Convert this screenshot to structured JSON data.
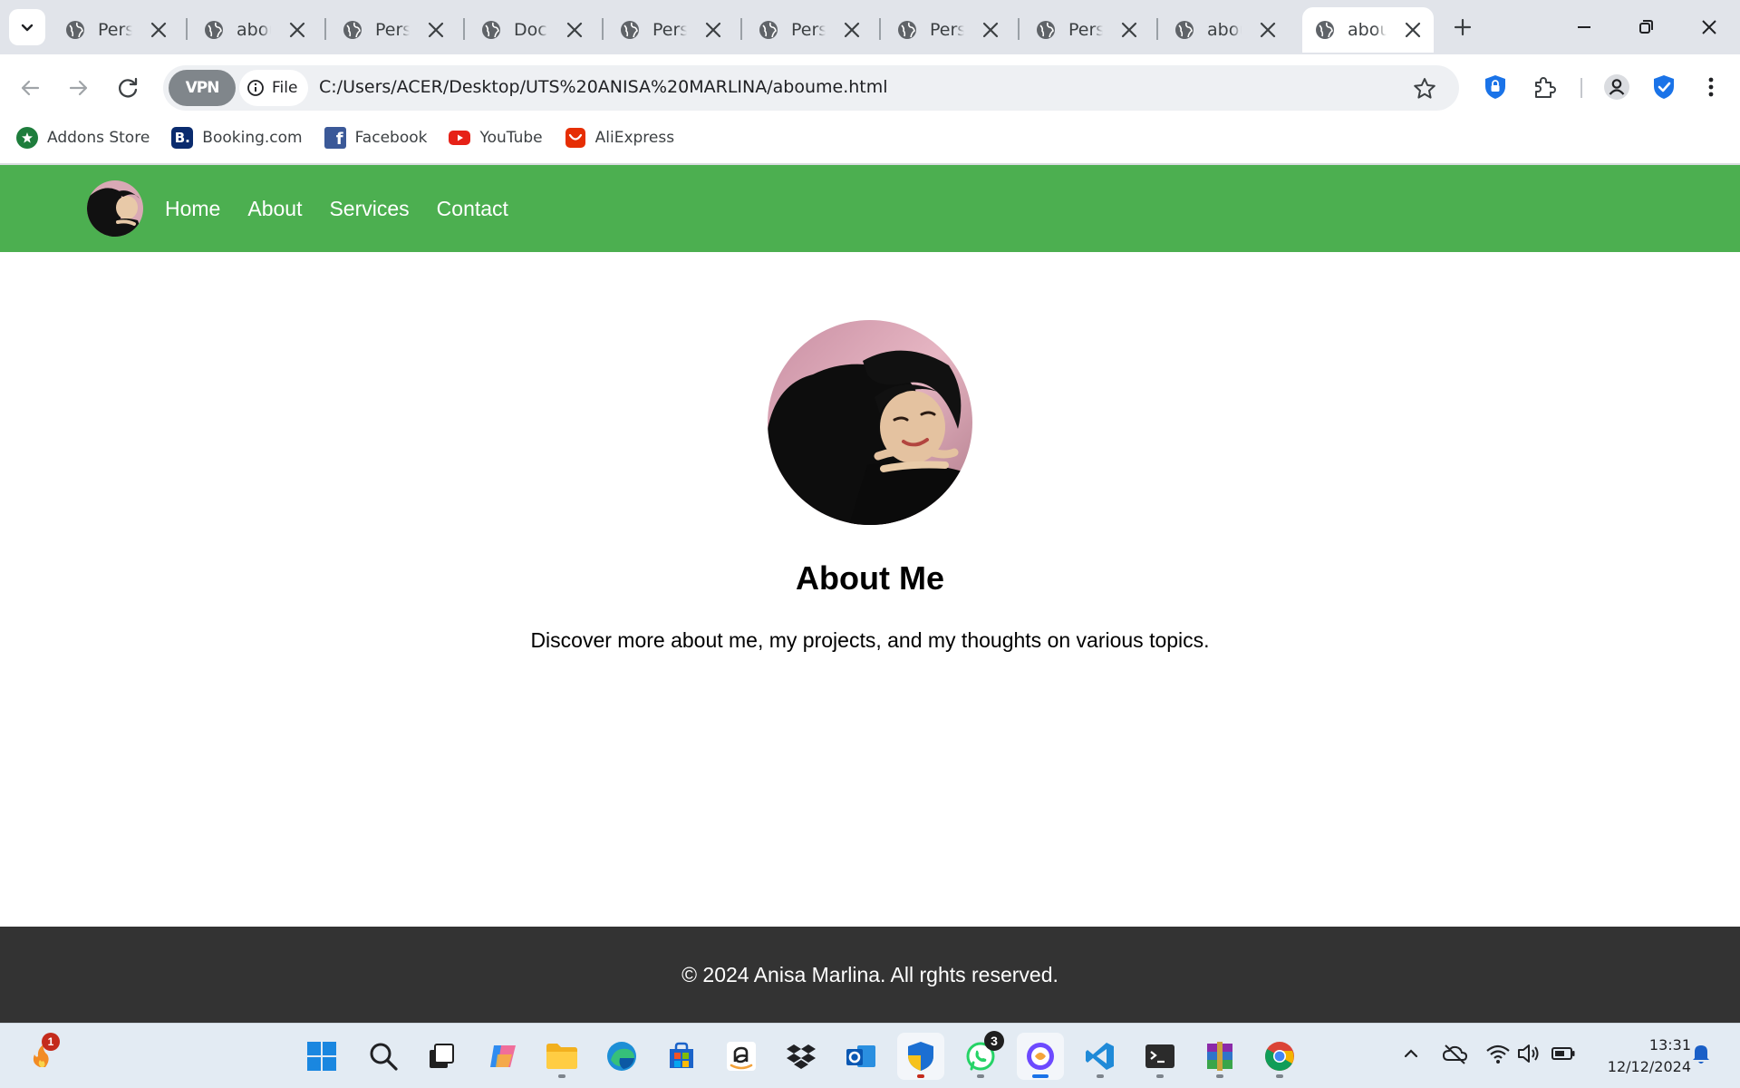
{
  "browser": {
    "tabs": [
      {
        "title": "Personal Website"
      },
      {
        "title": "about"
      },
      {
        "title": "Personal Website"
      },
      {
        "title": "Document"
      },
      {
        "title": "Personal Website"
      },
      {
        "title": "Personal Website"
      },
      {
        "title": "Personal Website"
      },
      {
        "title": "Personal Website"
      },
      {
        "title": "aboume"
      },
      {
        "title": "about"
      }
    ],
    "vpn_label": "VPN",
    "file_chip": "File",
    "url": "C:/Users/ACER/Desktop/UTS%20ANISA%20MARLINA/aboume.html",
    "bookmarks": [
      {
        "label": "Addons Store",
        "color": "#1e7d3c"
      },
      {
        "label": "Booking.com",
        "color": "#0a2b6e",
        "glyph": "B."
      },
      {
        "label": "Facebook",
        "color": "#3b5998",
        "glyph": "f"
      },
      {
        "label": "YouTube",
        "color": "#e62117"
      },
      {
        "label": "AliExpress",
        "color": "#e62e04"
      }
    ]
  },
  "site": {
    "nav_links": [
      "Home",
      "About",
      "Services",
      "Contact"
    ],
    "heading": "About Me",
    "description": "Discover more about me, my projects, and my thoughts on various topics.",
    "footer": "© 2024 Anisa Marlina. All rghts reserved.",
    "accent_color": "#4caf50"
  },
  "taskbar": {
    "notification_badge": "1",
    "whatsapp_badge": "3",
    "time": "13:31",
    "date": "12/12/2024"
  }
}
